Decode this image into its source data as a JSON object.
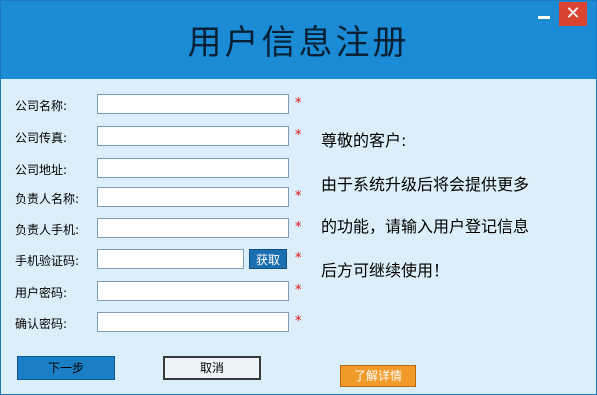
{
  "window": {
    "title": "用户信息注册",
    "close_label": "✕"
  },
  "form": {
    "fields": [
      {
        "label": "公司名称:",
        "value": "",
        "required": "*"
      },
      {
        "label": "公司传真:",
        "value": "",
        "required": "*"
      },
      {
        "label": "公司地址:",
        "value": "",
        "required": ""
      },
      {
        "label": "负责人名称:",
        "value": "",
        "required": "*"
      },
      {
        "label": "负责人手机:",
        "value": "",
        "required": "*"
      },
      {
        "label": "手机验证码:",
        "value": "",
        "required": "*"
      },
      {
        "label": "用户密码:",
        "value": "",
        "required": "*"
      },
      {
        "label": "确认密码:",
        "value": "",
        "required": "*"
      }
    ],
    "fetch_code_label": "获取"
  },
  "notice": {
    "lines": [
      "尊敬的客户:",
      "由于系统升级后将会提供更多",
      "的功能，请输入用户登记信息",
      "后方可继续使用！"
    ]
  },
  "buttons": {
    "next_label": "下一步",
    "cancel_label": "取消",
    "details_label": "了解详情"
  },
  "colors": {
    "titlebar": "#1a8bd4",
    "background": "#dceef9",
    "required": "#e01010",
    "details_button": "#f09a2a",
    "close_button": "#d9432f"
  }
}
